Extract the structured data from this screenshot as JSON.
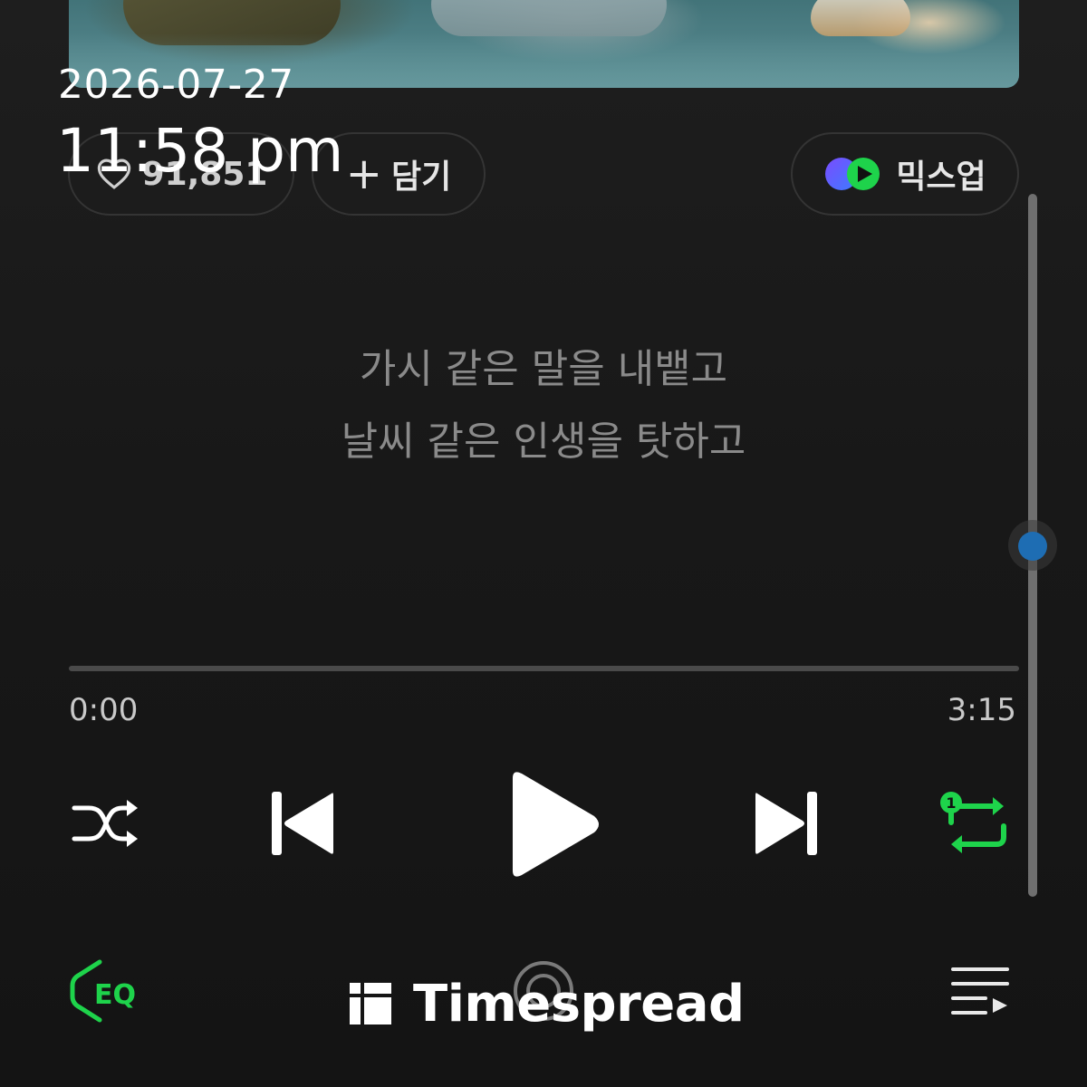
{
  "overlay": {
    "date": "2026-07-27",
    "time": "11:58 pm"
  },
  "actions": {
    "like_count": "91,851",
    "add_label": "담기",
    "mixup_label": "믹스업"
  },
  "lyrics": {
    "lines": [
      "가시 같은 말을 내뱉고",
      "날씨 같은 인생을 탓하고"
    ]
  },
  "player": {
    "current_time": "0:00",
    "total_time": "3:15",
    "progress": 0,
    "repeat_mode_badge": "1"
  },
  "bottom_bar": {
    "eq_label": "EQ"
  },
  "watermark": {
    "text": "Timespread"
  },
  "colors": {
    "accent_green": "#1ed34b",
    "scroll_thumb_blue": "#1e6db3",
    "background": "#181818",
    "lyrics_text": "#8a8a8a"
  },
  "icons": {
    "like": "heart-icon",
    "add": "plus-icon",
    "mixup": "mixup-logo-icon",
    "shuffle": "shuffle-icon",
    "prev": "skip-previous-icon",
    "play": "play-icon",
    "next": "skip-next-icon",
    "repeat": "repeat-one-icon",
    "eq": "equalizer-icon",
    "center": "lens-icon",
    "queue": "playlist-queue-icon"
  }
}
